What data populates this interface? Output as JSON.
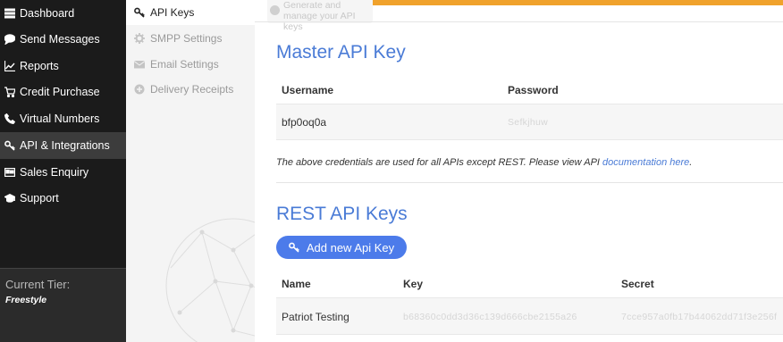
{
  "sidebar": {
    "items": [
      {
        "label": "Dashboard",
        "icon": "menu-icon"
      },
      {
        "label": "Send Messages",
        "icon": "chat-icon"
      },
      {
        "label": "Reports",
        "icon": "line-chart-icon"
      },
      {
        "label": "Credit Purchase",
        "icon": "cart-icon"
      },
      {
        "label": "Virtual Numbers",
        "icon": "phone-icon"
      },
      {
        "label": "API & Integrations",
        "icon": "key-icon"
      },
      {
        "label": "Sales Enquiry",
        "icon": "card-icon"
      },
      {
        "label": "Support",
        "icon": "graduation-cap-icon"
      }
    ],
    "tier_label": "Current Tier:",
    "tier_value": "Freestyle"
  },
  "subnav": {
    "items": [
      {
        "label": "API Keys",
        "icon": "key-icon"
      },
      {
        "label": "SMPP Settings",
        "icon": "gear-icon"
      },
      {
        "label": "Email Settings",
        "icon": "envelope-icon"
      },
      {
        "label": "Delivery Receipts",
        "icon": "plus-circle-icon"
      }
    ]
  },
  "notice": {
    "text": "Generate and manage your API keys"
  },
  "master": {
    "title": "Master API Key",
    "col_username": "Username",
    "col_password": "Password",
    "username": "bfp0oq0a",
    "password": "Sefkjhuw",
    "note_text": "The above credentials are used for all APIs except REST. Please view API ",
    "note_link": "documentation here",
    "note_end": "."
  },
  "rest": {
    "title": "REST API Keys",
    "add_button": "Add new Api Key",
    "col_name": "Name",
    "col_key": "Key",
    "col_secret": "Secret",
    "rows": [
      {
        "name": "Patriot Testing",
        "key": "b68360c0dd3d36c139d666cbe2155a26",
        "secret": "7cce957a0fb17b44062dd71f3e256f"
      }
    ]
  },
  "colors": {
    "accent": "#4a7bd6",
    "button": "#4c7bea",
    "warning": "#f0a22c",
    "sidebar": "#1b1b1b"
  }
}
